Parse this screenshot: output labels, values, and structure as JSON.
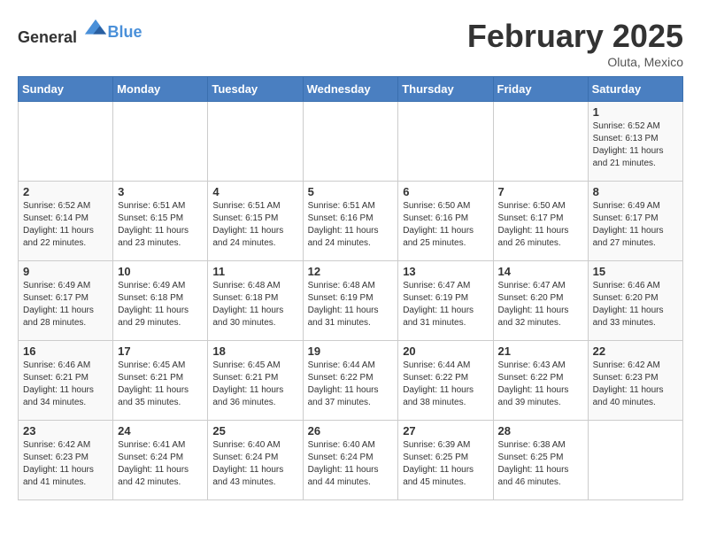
{
  "logo": {
    "general": "General",
    "blue": "Blue"
  },
  "header": {
    "month": "February 2025",
    "location": "Oluta, Mexico"
  },
  "weekdays": [
    "Sunday",
    "Monday",
    "Tuesday",
    "Wednesday",
    "Thursday",
    "Friday",
    "Saturday"
  ],
  "weeks": [
    [
      {
        "day": "",
        "info": ""
      },
      {
        "day": "",
        "info": ""
      },
      {
        "day": "",
        "info": ""
      },
      {
        "day": "",
        "info": ""
      },
      {
        "day": "",
        "info": ""
      },
      {
        "day": "",
        "info": ""
      },
      {
        "day": "1",
        "info": "Sunrise: 6:52 AM\nSunset: 6:13 PM\nDaylight: 11 hours\nand 21 minutes."
      }
    ],
    [
      {
        "day": "2",
        "info": "Sunrise: 6:52 AM\nSunset: 6:14 PM\nDaylight: 11 hours\nand 22 minutes."
      },
      {
        "day": "3",
        "info": "Sunrise: 6:51 AM\nSunset: 6:15 PM\nDaylight: 11 hours\nand 23 minutes."
      },
      {
        "day": "4",
        "info": "Sunrise: 6:51 AM\nSunset: 6:15 PM\nDaylight: 11 hours\nand 24 minutes."
      },
      {
        "day": "5",
        "info": "Sunrise: 6:51 AM\nSunset: 6:16 PM\nDaylight: 11 hours\nand 24 minutes."
      },
      {
        "day": "6",
        "info": "Sunrise: 6:50 AM\nSunset: 6:16 PM\nDaylight: 11 hours\nand 25 minutes."
      },
      {
        "day": "7",
        "info": "Sunrise: 6:50 AM\nSunset: 6:17 PM\nDaylight: 11 hours\nand 26 minutes."
      },
      {
        "day": "8",
        "info": "Sunrise: 6:49 AM\nSunset: 6:17 PM\nDaylight: 11 hours\nand 27 minutes."
      }
    ],
    [
      {
        "day": "9",
        "info": "Sunrise: 6:49 AM\nSunset: 6:17 PM\nDaylight: 11 hours\nand 28 minutes."
      },
      {
        "day": "10",
        "info": "Sunrise: 6:49 AM\nSunset: 6:18 PM\nDaylight: 11 hours\nand 29 minutes."
      },
      {
        "day": "11",
        "info": "Sunrise: 6:48 AM\nSunset: 6:18 PM\nDaylight: 11 hours\nand 30 minutes."
      },
      {
        "day": "12",
        "info": "Sunrise: 6:48 AM\nSunset: 6:19 PM\nDaylight: 11 hours\nand 31 minutes."
      },
      {
        "day": "13",
        "info": "Sunrise: 6:47 AM\nSunset: 6:19 PM\nDaylight: 11 hours\nand 31 minutes."
      },
      {
        "day": "14",
        "info": "Sunrise: 6:47 AM\nSunset: 6:20 PM\nDaylight: 11 hours\nand 32 minutes."
      },
      {
        "day": "15",
        "info": "Sunrise: 6:46 AM\nSunset: 6:20 PM\nDaylight: 11 hours\nand 33 minutes."
      }
    ],
    [
      {
        "day": "16",
        "info": "Sunrise: 6:46 AM\nSunset: 6:21 PM\nDaylight: 11 hours\nand 34 minutes."
      },
      {
        "day": "17",
        "info": "Sunrise: 6:45 AM\nSunset: 6:21 PM\nDaylight: 11 hours\nand 35 minutes."
      },
      {
        "day": "18",
        "info": "Sunrise: 6:45 AM\nSunset: 6:21 PM\nDaylight: 11 hours\nand 36 minutes."
      },
      {
        "day": "19",
        "info": "Sunrise: 6:44 AM\nSunset: 6:22 PM\nDaylight: 11 hours\nand 37 minutes."
      },
      {
        "day": "20",
        "info": "Sunrise: 6:44 AM\nSunset: 6:22 PM\nDaylight: 11 hours\nand 38 minutes."
      },
      {
        "day": "21",
        "info": "Sunrise: 6:43 AM\nSunset: 6:22 PM\nDaylight: 11 hours\nand 39 minutes."
      },
      {
        "day": "22",
        "info": "Sunrise: 6:42 AM\nSunset: 6:23 PM\nDaylight: 11 hours\nand 40 minutes."
      }
    ],
    [
      {
        "day": "23",
        "info": "Sunrise: 6:42 AM\nSunset: 6:23 PM\nDaylight: 11 hours\nand 41 minutes."
      },
      {
        "day": "24",
        "info": "Sunrise: 6:41 AM\nSunset: 6:24 PM\nDaylight: 11 hours\nand 42 minutes."
      },
      {
        "day": "25",
        "info": "Sunrise: 6:40 AM\nSunset: 6:24 PM\nDaylight: 11 hours\nand 43 minutes."
      },
      {
        "day": "26",
        "info": "Sunrise: 6:40 AM\nSunset: 6:24 PM\nDaylight: 11 hours\nand 44 minutes."
      },
      {
        "day": "27",
        "info": "Sunrise: 6:39 AM\nSunset: 6:25 PM\nDaylight: 11 hours\nand 45 minutes."
      },
      {
        "day": "28",
        "info": "Sunrise: 6:38 AM\nSunset: 6:25 PM\nDaylight: 11 hours\nand 46 minutes."
      },
      {
        "day": "",
        "info": ""
      }
    ]
  ]
}
